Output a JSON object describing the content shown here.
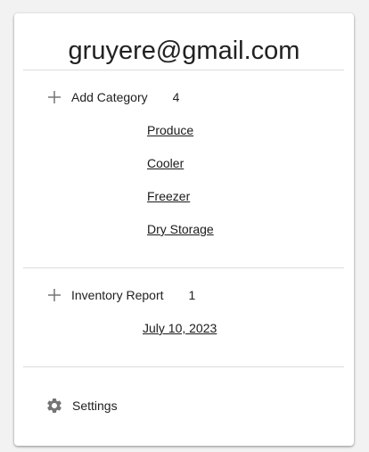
{
  "account": {
    "email": "gruyere@gmail.com"
  },
  "categories": {
    "add_label": "Add Category",
    "count": "4",
    "items": [
      "Produce",
      "Cooler",
      "Freezer",
      "Dry Storage"
    ]
  },
  "inventory": {
    "label": "Inventory Report",
    "count": "1",
    "reports": [
      "July 10, 2023"
    ]
  },
  "settings": {
    "label": "Settings"
  },
  "colors": {
    "text": "#212121",
    "icon": "#757575",
    "divider": "#dcdcdc"
  },
  "icons": {
    "add": "plus-icon",
    "settings": "gear-icon"
  }
}
